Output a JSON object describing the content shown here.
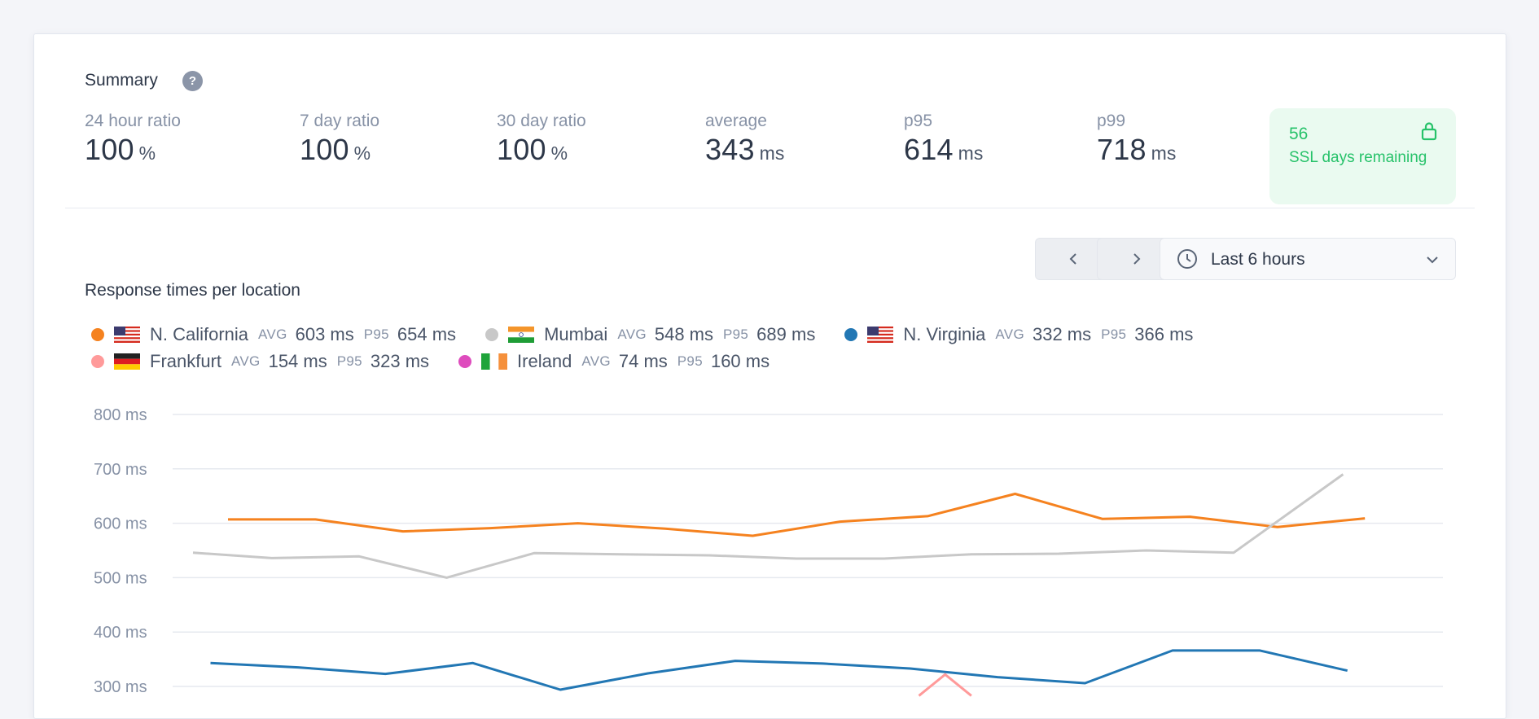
{
  "summary": {
    "title": "Summary",
    "help_glyph": "?",
    "stats": [
      {
        "label": "24 hour ratio",
        "value": "100",
        "unit": "%"
      },
      {
        "label": "7 day ratio",
        "value": "100",
        "unit": "%"
      },
      {
        "label": "30 day ratio",
        "value": "100",
        "unit": "%"
      },
      {
        "label": "average",
        "value": "343",
        "unit": "ms"
      },
      {
        "label": "p95",
        "value": "614",
        "unit": "ms"
      },
      {
        "label": "p99",
        "value": "718",
        "unit": "ms"
      }
    ],
    "ssl": {
      "days": "56",
      "label": "SSL days remaining",
      "icon": "lock-icon",
      "color": "#27c26a"
    }
  },
  "controls": {
    "prev_icon": "chevron-left-icon",
    "next_icon": "chevron-right-icon",
    "range_label": "Last 6 hours",
    "range_icon": "clock-icon"
  },
  "chart_title": "Response times per location",
  "legend": [
    {
      "name": "N. California",
      "color": "#f5821f",
      "flag": "us",
      "avg_tag": "AVG",
      "avg": "603 ms",
      "p95_tag": "P95",
      "p95": "654 ms"
    },
    {
      "name": "Mumbai",
      "color": "#c8c8c8",
      "flag": "in",
      "avg_tag": "AVG",
      "avg": "548 ms",
      "p95_tag": "P95",
      "p95": "689 ms"
    },
    {
      "name": "N. Virginia",
      "color": "#2277b4",
      "flag": "us",
      "avg_tag": "AVG",
      "avg": "332 ms",
      "p95_tag": "P95",
      "p95": "366 ms"
    },
    {
      "name": "Frankfurt",
      "color": "#ff9a9a",
      "flag": "de",
      "avg_tag": "AVG",
      "avg": "154 ms",
      "p95_tag": "P95",
      "p95": "323 ms"
    },
    {
      "name": "Ireland",
      "color": "#de4cbd",
      "flag": "ie",
      "avg_tag": "AVG",
      "avg": "74 ms",
      "p95_tag": "P95",
      "p95": "160 ms"
    }
  ],
  "chart_data": {
    "type": "line",
    "ylim": [
      300,
      800
    ],
    "y_ticks": [
      "800 ms",
      "700 ms",
      "600 ms",
      "500 ms",
      "400 ms",
      "300 ms"
    ],
    "y_tick_values": [
      800,
      700,
      600,
      500,
      400,
      300
    ],
    "grid": true,
    "series": [
      {
        "name": "N. California",
        "color": "#f5821f",
        "x": [
          1,
          2,
          3,
          4,
          5,
          6,
          7,
          8,
          9,
          10,
          11,
          12,
          13,
          14
        ],
        "values": [
          607,
          607,
          585,
          591,
          600,
          590,
          577,
          603,
          613,
          654,
          608,
          612,
          593,
          609
        ]
      },
      {
        "name": "Mumbai",
        "color": "#c8c8c8",
        "x": [
          0.6,
          1.5,
          2.5,
          3.5,
          4.5,
          5.5,
          6.5,
          7.5,
          8.5,
          9.5,
          10.5,
          11.5,
          12.5,
          13.75
        ],
        "values": [
          546,
          536,
          539,
          500,
          545,
          543,
          541,
          535,
          535,
          543,
          544,
          550,
          546,
          690
        ]
      },
      {
        "name": "N. Virginia",
        "color": "#2277b4",
        "x": [
          0.8,
          1.8,
          2.8,
          3.8,
          4.8,
          5.8,
          6.8,
          7.8,
          8.8,
          9.8,
          10.8,
          11.8,
          12.8,
          13.8
        ],
        "values": [
          343,
          335,
          323,
          343,
          294,
          324,
          347,
          342,
          333,
          317,
          306,
          366,
          366,
          329
        ]
      },
      {
        "name": "Frankfurt",
        "color": "#ff9a9a",
        "x": [
          8.9,
          9.2,
          9.5
        ],
        "values": [
          283,
          322,
          283
        ]
      }
    ]
  }
}
